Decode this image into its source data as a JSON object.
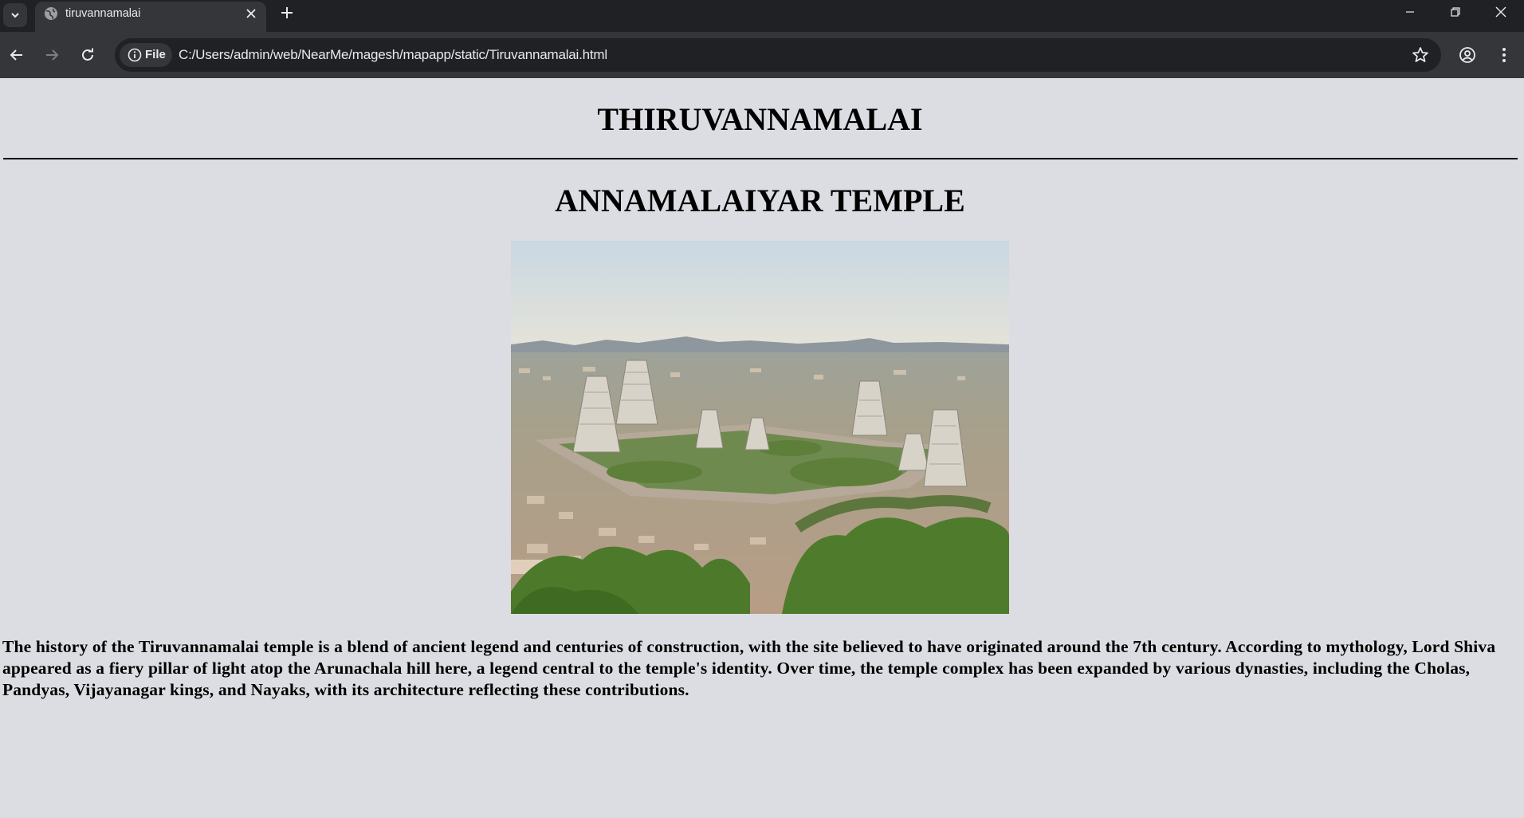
{
  "browser": {
    "tab_title": "tiruvannamalai",
    "site_chip": "File",
    "url": "C:/Users/admin/web/NearMe/magesh/mapapp/static/Tiruvannamalai.html",
    "theme_color": "#35363a"
  },
  "page": {
    "heading": "THIRUVANNAMALAI",
    "subheading": "ANNAMALAIYAR TEMPLE",
    "image_subject": "aerial view of Annamalaiyar temple complex with gopuram towers",
    "description": "The history of the Tiruvannamalai temple is a blend of ancient legend and centuries of construction, with the site believed to have originated around the 7th century. According to mythology, Lord Shiva appeared as a fiery pillar of light atop the Arunachala hill here, a legend central to the temple's identity. Over time, the temple complex has been expanded by various dynasties, including the Cholas, Pandyas, Vijayanagar kings, and Nayaks, with its architecture reflecting these contributions.",
    "background_color": "#dcdde2"
  }
}
